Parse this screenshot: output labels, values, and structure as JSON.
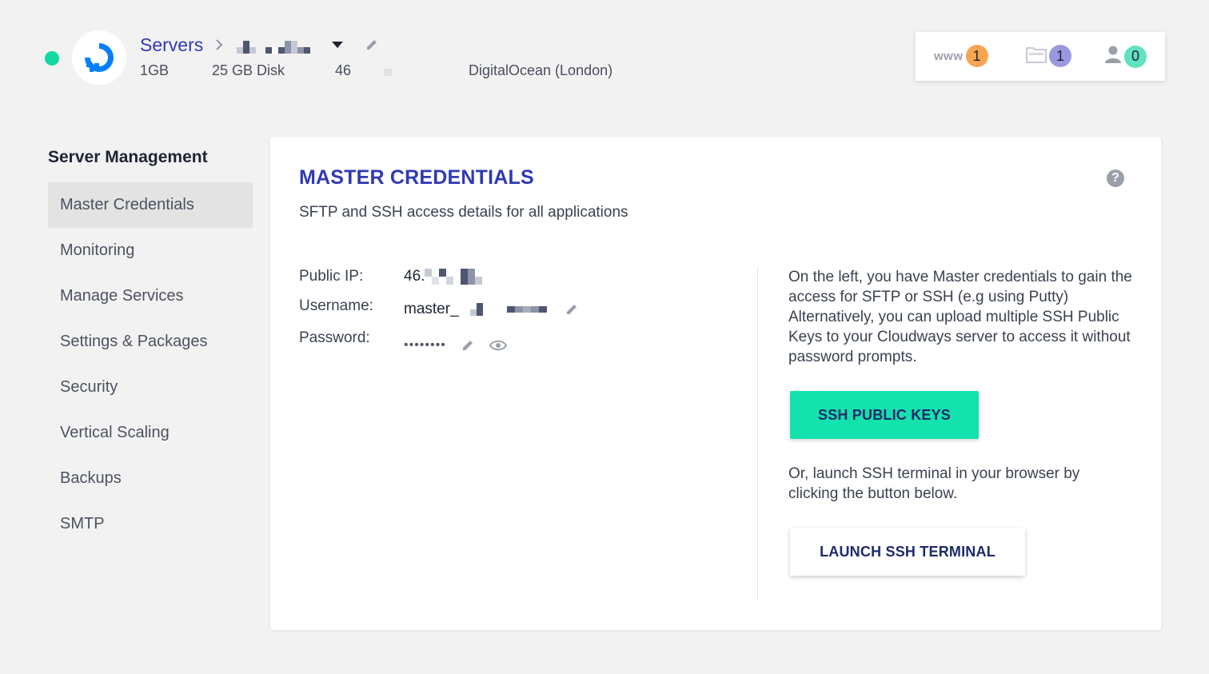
{
  "server": {
    "status_color": "#12d9a4",
    "provider_logo": "digitalocean-logo",
    "breadcrumb_root": "Servers",
    "specs": {
      "ram": "1GB",
      "disk": "25 GB Disk",
      "ip_prefix": "46",
      "location": "DigitalOcean (London)"
    }
  },
  "counters": {
    "apps": {
      "label": "www",
      "count": "1",
      "color": "#f7a550"
    },
    "projects": {
      "icon": "folder-icon",
      "count": "1",
      "color": "#9b98e0"
    },
    "team": {
      "icon": "user-icon",
      "count": "0",
      "color": "#5ee2bf"
    }
  },
  "sidebar": {
    "title": "Server Management",
    "items": [
      {
        "label": "Master Credentials",
        "active": true
      },
      {
        "label": "Monitoring"
      },
      {
        "label": "Manage Services"
      },
      {
        "label": "Settings & Packages"
      },
      {
        "label": "Security"
      },
      {
        "label": "Vertical Scaling"
      },
      {
        "label": "Backups"
      },
      {
        "label": "SMTP"
      }
    ]
  },
  "card": {
    "title": "MASTER CREDENTIALS",
    "subtitle": "SFTP and SSH access details for all applications",
    "credentials": {
      "public_ip_label": "Public IP:",
      "public_ip_value": "46.",
      "username_label": "Username:",
      "username_value": "master_",
      "password_label": "Password:",
      "password_value": "••••••••"
    },
    "info_text_1": "On the left, you have Master credentials to gain the access for SFTP or SSH (e.g using Putty) Alternatively, you can upload multiple SSH Public Keys to your Cloudways server to access it without password prompts.",
    "ssh_keys_button": "SSH PUBLIC KEYS",
    "info_text_2": "Or, launch SSH terminal in your browser by clicking the button below.",
    "launch_button": "LAUNCH SSH TERMINAL"
  },
  "colors": {
    "accent": "#2f3ab2",
    "primary_button": "#14e2ad",
    "button_text": "#1d2a6b"
  }
}
